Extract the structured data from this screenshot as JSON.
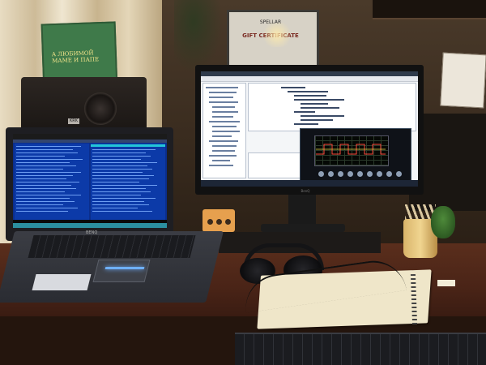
{
  "photo": {
    "description_kind": "photo of a desk workstation",
    "gift_certificate": {
      "brand": "SPELLAR",
      "title": "GIFT CERTIFICATE"
    },
    "postcard": {
      "text": "A ЛЮБИМОЙ МАМЕ И ПАПЕ"
    },
    "speaker_badge": "KRK",
    "laptop_brand": "BENQ",
    "monitor_brand": "BenQ",
    "colors": {
      "file_manager_blue": "#0c3aa8",
      "scope_background": "#0f1218",
      "desk_wood": "#5a2e1c",
      "audio_interface": "#e6a04e"
    }
  }
}
